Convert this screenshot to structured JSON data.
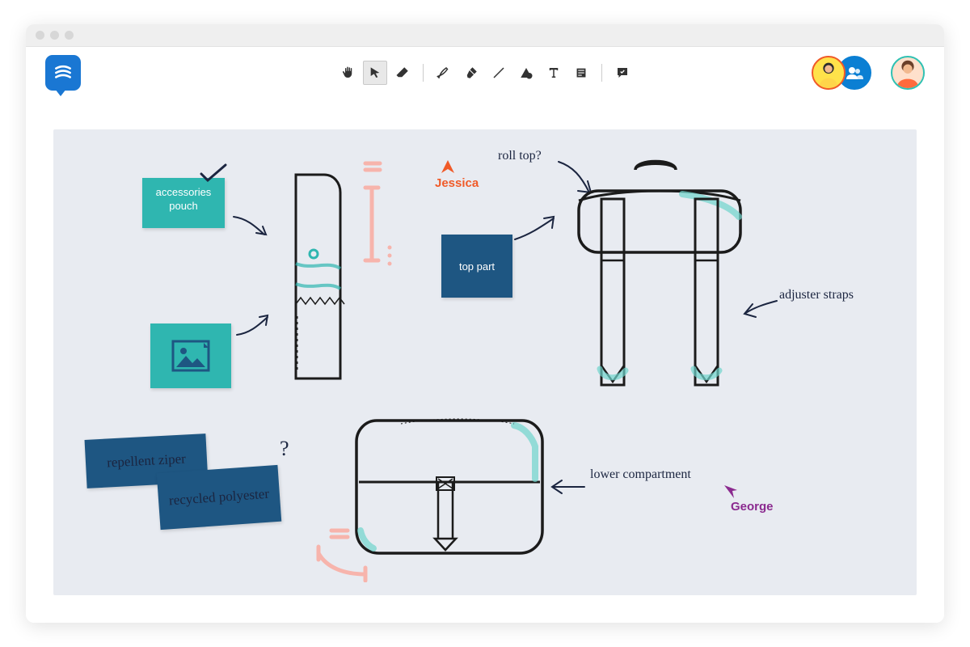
{
  "notes": {
    "accessories": "accessories pouch",
    "top_part": "top part",
    "repellent": "repellent ziper",
    "recycled": "recycled polyester"
  },
  "annotations": {
    "roll_top": "roll top?",
    "adjuster": "adjuster straps",
    "lower": "lower compartment",
    "question": "?"
  },
  "cursors": {
    "jessica": "Jessica",
    "george": "George"
  },
  "colors": {
    "jessica": "#f05a28",
    "george": "#8b2a8f"
  }
}
